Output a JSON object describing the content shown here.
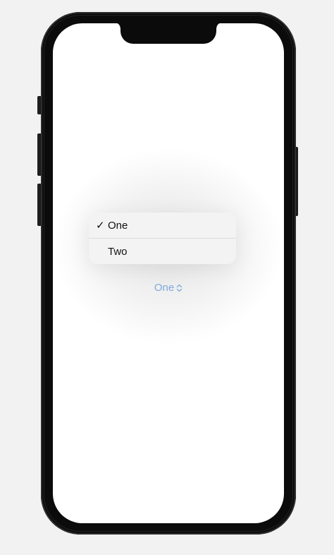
{
  "menu": {
    "items": [
      {
        "label": "One",
        "selected": true,
        "check": "✓"
      },
      {
        "label": "Two",
        "selected": false,
        "check": ""
      }
    ]
  },
  "picker": {
    "value": "One",
    "icon": "chevron-up-down-icon",
    "color": "#7fa9dc"
  }
}
